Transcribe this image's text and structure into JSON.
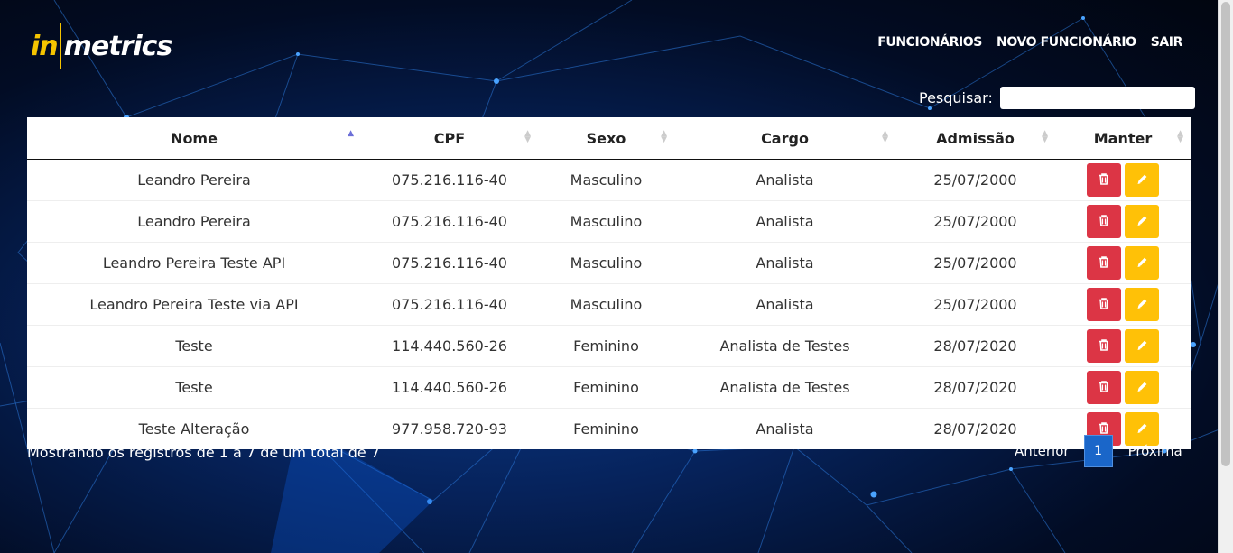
{
  "logo": {
    "part1": "in",
    "part2": "metrics"
  },
  "nav": [
    {
      "label": "FUNCIONÁRIOS"
    },
    {
      "label": "NOVO FUNCIONÁRIO"
    },
    {
      "label": "SAIR"
    }
  ],
  "search": {
    "label": "Pesquisar:",
    "value": ""
  },
  "table": {
    "headers": [
      "Nome",
      "CPF",
      "Sexo",
      "Cargo",
      "Admissão",
      "Manter"
    ],
    "rows": [
      {
        "nome": "Leandro Pereira",
        "cpf": "075.216.116-40",
        "sexo": "Masculino",
        "cargo": "Analista",
        "admissao": "25/07/2000"
      },
      {
        "nome": "Leandro Pereira",
        "cpf": "075.216.116-40",
        "sexo": "Masculino",
        "cargo": "Analista",
        "admissao": "25/07/2000"
      },
      {
        "nome": "Leandro Pereira Teste API",
        "cpf": "075.216.116-40",
        "sexo": "Masculino",
        "cargo": "Analista",
        "admissao": "25/07/2000"
      },
      {
        "nome": "Leandro Pereira Teste via API",
        "cpf": "075.216.116-40",
        "sexo": "Masculino",
        "cargo": "Analista",
        "admissao": "25/07/2000"
      },
      {
        "nome": "Teste",
        "cpf": "114.440.560-26",
        "sexo": "Feminino",
        "cargo": "Analista de Testes",
        "admissao": "28/07/2020"
      },
      {
        "nome": "Teste",
        "cpf": "114.440.560-26",
        "sexo": "Feminino",
        "cargo": "Analista de Testes",
        "admissao": "28/07/2020"
      },
      {
        "nome": "Teste Alteração",
        "cpf": "977.958.720-93",
        "sexo": "Feminino",
        "cargo": "Analista",
        "admissao": "28/07/2020"
      }
    ],
    "sorted_column": "Nome",
    "sort_direction": "asc"
  },
  "footer": {
    "info": "Mostrando os registros de 1 a 7 de um total de 7",
    "prev": "Anterior",
    "page": "1",
    "next": "Próxima"
  },
  "colors": {
    "accent": "#f5c400",
    "delete": "#dc3545",
    "edit": "#ffc107",
    "page_active": "#1a66c9"
  },
  "icons": {
    "delete": "trash-icon",
    "edit": "pencil-icon"
  }
}
